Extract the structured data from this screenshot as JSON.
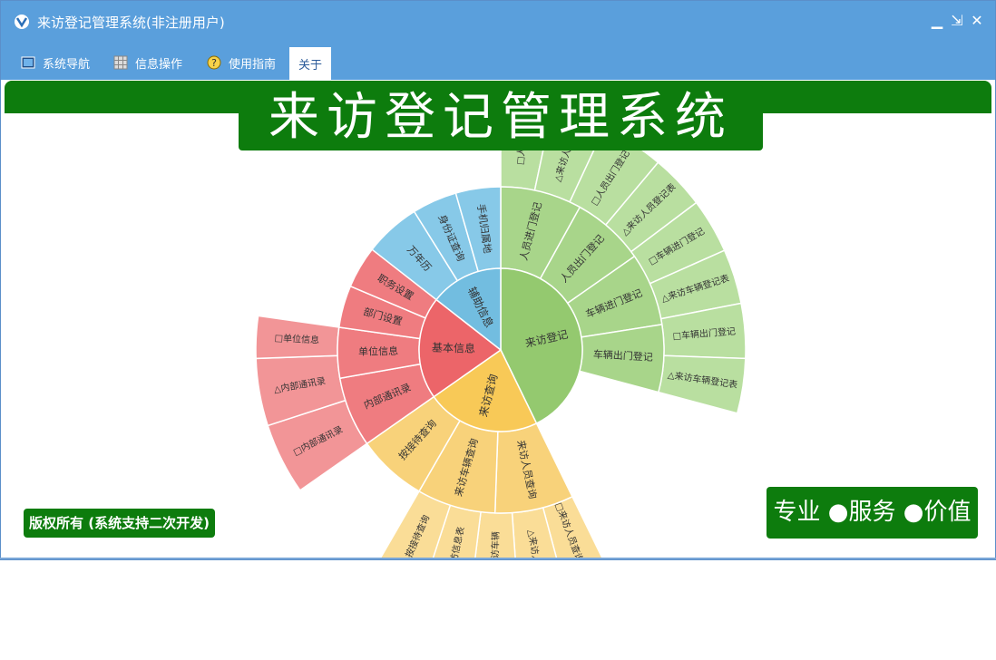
{
  "window": {
    "title": "来访登记管理系统(非注册用户)",
    "controls": {
      "minimize": "▁",
      "restore": "⇲",
      "close": "✕"
    }
  },
  "menu": [
    {
      "label": "系统导航",
      "icon": "window-icon"
    },
    {
      "label": "信息操作",
      "icon": "grid-icon"
    },
    {
      "label": "使用指南",
      "icon": "help-icon"
    },
    {
      "label": "关于",
      "icon": ""
    }
  ],
  "banner": {
    "title": "来访登记管理系统"
  },
  "footer": {
    "copyright": "版权所有 (系统支持二次开发)",
    "slogan": "专业 ●服务 ●价值"
  },
  "colors": {
    "titlebar": "#5a9fdc",
    "brand_green": "#0d7c0d",
    "green_inner": "#94c96f",
    "green_mid": "#a8d58a",
    "green_outer": "#b9dfa0",
    "yellow_inner": "#f8c957",
    "yellow_mid": "#f8d27a",
    "yellow_outer": "#fadd97",
    "red_inner": "#ec6569",
    "red_mid": "#ef7c80",
    "red_outer": "#f29597",
    "blue_inner": "#72bde0",
    "blue_mid": "#87c9e8"
  },
  "sunburst": {
    "inner": [
      {
        "label": "来访登记",
        "color": "green_inner"
      },
      {
        "label": "来访查询",
        "color": "yellow_inner"
      },
      {
        "label": "基本信息",
        "color": "red_inner"
      },
      {
        "label": "辅助信息",
        "color": "blue_inner"
      }
    ],
    "mid": [
      {
        "label": "人员进门登记",
        "color": "green_mid"
      },
      {
        "label": "人员出门登记",
        "color": "green_mid"
      },
      {
        "label": "车辆进门登记",
        "color": "green_mid"
      },
      {
        "label": "车辆出门登记",
        "color": "green_mid"
      },
      {
        "label": "来访人员查询",
        "color": "yellow_mid"
      },
      {
        "label": "来访车辆查询",
        "color": "yellow_mid"
      },
      {
        "label": "按接待查询",
        "color": "yellow_mid"
      },
      {
        "label": "内部通讯录",
        "color": "red_mid"
      },
      {
        "label": "单位信息",
        "color": "red_mid"
      },
      {
        "label": "部门设置",
        "color": "red_mid"
      },
      {
        "label": "职务设置",
        "color": "red_mid"
      },
      {
        "label": "万年历",
        "color": "blue_mid"
      },
      {
        "label": "身份证查询",
        "color": "blue_mid"
      },
      {
        "label": "手机归属地",
        "color": "blue_mid"
      }
    ],
    "outer": [
      {
        "label": "□人员进",
        "color": "green_outer"
      },
      {
        "label": "△来访人员登",
        "color": "green_outer"
      },
      {
        "label": "□人员出门登记",
        "color": "green_outer"
      },
      {
        "label": "△来访人员登记表",
        "color": "green_outer"
      },
      {
        "label": "□车辆进门登记",
        "color": "green_outer"
      },
      {
        "label": "△来访车辆登记表",
        "color": "green_outer"
      },
      {
        "label": "□车辆出门登记",
        "color": "green_outer"
      },
      {
        "label": "△来访车辆登记表",
        "color": "green_outer"
      },
      {
        "label": "□来访人员查询信息",
        "color": "yellow_outer"
      },
      {
        "label": "△来访人员",
        "color": "yellow_outer"
      },
      {
        "label": "□来访车辆",
        "color": "yellow_outer"
      },
      {
        "label": "来访信息表",
        "color": "yellow_outer"
      },
      {
        "label": "按接待查询",
        "color": "yellow_outer"
      },
      {
        "label": "□内部通讯录",
        "color": "red_outer"
      },
      {
        "label": "△内部通讯录",
        "color": "red_outer"
      },
      {
        "label": "□单位信息",
        "color": "red_outer"
      }
    ]
  }
}
